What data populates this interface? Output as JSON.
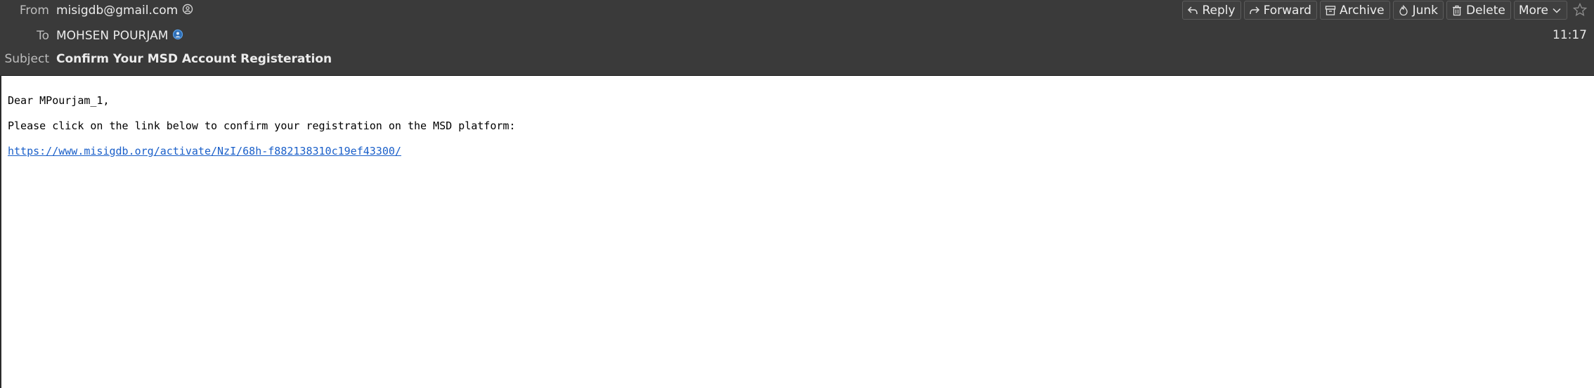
{
  "header": {
    "from_label": "From",
    "from_value": "misigdb@gmail.com",
    "to_label": "To",
    "to_value": "MOHSEN POURJAM",
    "subject_label": "Subject",
    "subject_value": "Confirm Your MSD Account Registeration",
    "time": "11:17",
    "accent_color": "#3b8bdb"
  },
  "toolbar": {
    "reply": "Reply",
    "forward": "Forward",
    "archive": "Archive",
    "junk": "Junk",
    "delete": "Delete",
    "more": "More"
  },
  "message": {
    "greeting": "Dear MPourjam_1,",
    "instruction": "Please click on the link below to confirm your registration on the MSD platform:",
    "link": "https://www.misigdb.org/activate/NzI/68h-f882138310c19ef43300/"
  }
}
